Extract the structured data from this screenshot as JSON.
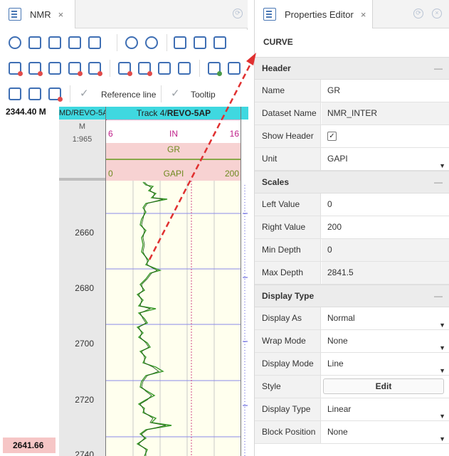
{
  "left_panel": {
    "tab": {
      "label": "NMR",
      "close": "×"
    },
    "toolbar2": {
      "reference_line": "Reference line",
      "tooltip": "Tooltip"
    },
    "depth_top": "2344.40 M",
    "depth_bottom": "2641.66",
    "ruler": {
      "header": "MD/REVO-5A",
      "unit": "M",
      "scale": "1:965",
      "ticks": [
        "2660",
        "2680",
        "2700",
        "2720",
        "2740"
      ]
    },
    "track": {
      "title_prefix": "Track 4/",
      "title_bold": "REVO-5AP",
      "curves": [
        {
          "left": "6",
          "unit": "IN",
          "right": "16",
          "color": "#c0208a"
        },
        {
          "name": "GR",
          "left": "0",
          "unit": "GAPI",
          "right": "200",
          "color": "#6e8a1f"
        }
      ]
    }
  },
  "right_panel": {
    "tab": {
      "label": "Properties Editor",
      "close": "×"
    },
    "title": "CURVE",
    "sections": [
      {
        "name": "Header",
        "collapse": "—",
        "rows": [
          {
            "label": "Name",
            "value": "GR",
            "kind": "text"
          },
          {
            "label": "Dataset Name",
            "value": "NMR_INTER",
            "kind": "readonly"
          },
          {
            "label": "Show Header",
            "value": "✓",
            "kind": "checkbox"
          },
          {
            "label": "Unit",
            "value": "GAPI",
            "kind": "select"
          }
        ]
      },
      {
        "name": "Scales",
        "collapse": "—",
        "rows": [
          {
            "label": "Left Value",
            "value": "0",
            "kind": "text"
          },
          {
            "label": "Right Value",
            "value": "200",
            "kind": "text"
          },
          {
            "label": "Min Depth",
            "value": "0",
            "kind": "readonly"
          },
          {
            "label": "Max Depth",
            "value": "2841.5",
            "kind": "readonly"
          }
        ]
      },
      {
        "name": "Display Type",
        "collapse": "—",
        "rows": [
          {
            "label": "Display As",
            "value": "Normal",
            "kind": "select"
          },
          {
            "label": "Wrap Mode",
            "value": "None",
            "kind": "select"
          },
          {
            "label": "Display Mode",
            "value": "Line",
            "kind": "select"
          },
          {
            "label": "Style",
            "value": "Edit",
            "kind": "button"
          },
          {
            "label": "Display Type",
            "value": "Linear",
            "kind": "select"
          },
          {
            "label": "Block Position",
            "value": "None",
            "kind": "select"
          }
        ]
      }
    ]
  },
  "colors": {
    "accent": "#3fd8e0",
    "plot_bg": "#ffffee",
    "curve": "#3a9a2a",
    "annotation": "#e03030"
  }
}
